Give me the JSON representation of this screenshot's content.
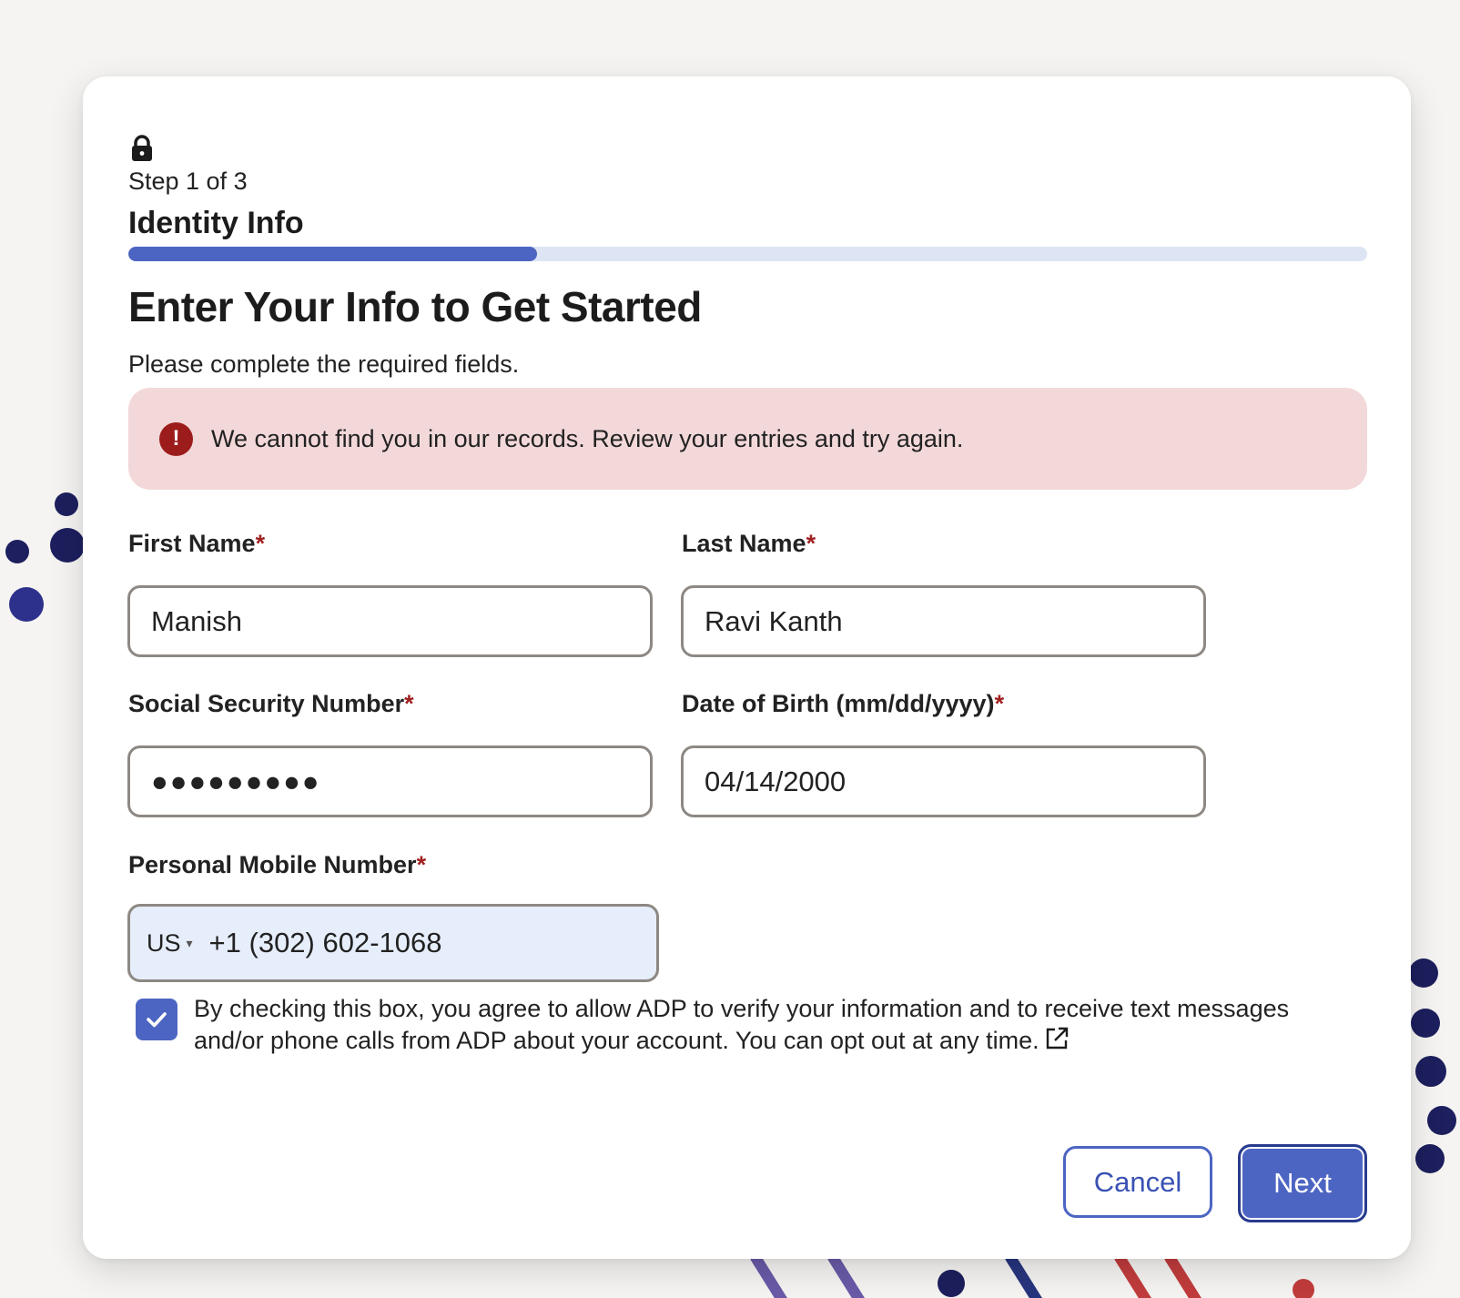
{
  "step": {
    "indicator": "Step 1 of 3",
    "title": "Identity Info",
    "progress_fraction": 0.33
  },
  "heading": "Enter Your Info to Get Started",
  "subtext": "Please complete the required fields.",
  "alert": {
    "icon": "!",
    "message": "We cannot find you in our records. Review your entries and try again."
  },
  "fields": {
    "first_name": {
      "label": "First Name",
      "required_mark": "*",
      "value": "Manish"
    },
    "last_name": {
      "label": "Last Name",
      "required_mark": "*",
      "value": "Ravi Kanth"
    },
    "ssn": {
      "label": "Social Security Number",
      "required_mark": "*",
      "value": "●●●●●●●●●"
    },
    "dob": {
      "label": "Date of Birth (mm/dd/yyyy)",
      "required_mark": "*",
      "value": "04/14/2000"
    },
    "phone": {
      "label": "Personal Mobile Number",
      "required_mark": "*",
      "country": "US",
      "value": "+1 (302) 602-1068"
    }
  },
  "consent": {
    "checked": true,
    "text": "By checking this box, you agree to allow ADP to verify your information and to receive text messages and/or phone calls from ADP about your account. You can opt out at any time."
  },
  "buttons": {
    "cancel": "Cancel",
    "next": "Next"
  },
  "colors": {
    "accent": "#4d65c2",
    "alert_bg": "#f3d8d9",
    "alert_icon": "#9c1c1c",
    "required": "#a12020",
    "progress_track": "#dde5f4",
    "phone_bg": "#e7eefb"
  },
  "icons": {
    "lock": "lock-icon",
    "alert": "error-icon",
    "checkbox": "checkmark-icon",
    "external_link": "external-link-icon",
    "dropdown": "caret-down-icon"
  }
}
